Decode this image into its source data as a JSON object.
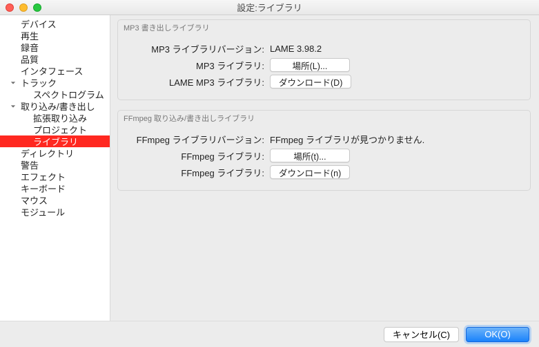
{
  "window": {
    "title": "設定:ライブラリ"
  },
  "sidebar": {
    "items": [
      {
        "label": "デバイス"
      },
      {
        "label": "再生"
      },
      {
        "label": "録音"
      },
      {
        "label": "品質"
      },
      {
        "label": "インタフェース"
      },
      {
        "label": "トラック"
      },
      {
        "label": "スペクトログラム"
      },
      {
        "label": "取り込み/書き出し"
      },
      {
        "label": "拡張取り込み"
      },
      {
        "label": "プロジェクト"
      },
      {
        "label": "ライブラリ"
      },
      {
        "label": "ディレクトリ"
      },
      {
        "label": "警告"
      },
      {
        "label": "エフェクト"
      },
      {
        "label": "キーボード"
      },
      {
        "label": "マウス"
      },
      {
        "label": "モジュール"
      }
    ]
  },
  "groups": {
    "mp3": {
      "title": "MP3 書き出しライブラリ",
      "rows": {
        "version_label": "MP3 ライブラリバージョン:",
        "version_value": "LAME 3.98.2",
        "lib_label": "MP3 ライブラリ:",
        "lib_button": "場所(L)...",
        "dl_label": "LAME MP3 ライブラリ:",
        "dl_button": "ダウンロード(D)"
      }
    },
    "ffmpeg": {
      "title": "FFmpeg 取り込み/書き出しライブラリ",
      "rows": {
        "version_label": "FFmpeg ライブラリバージョン:",
        "version_value": "FFmpeg ライブラリが見つかりません.",
        "lib_label": "FFmpeg ライブラリ:",
        "lib_button": "場所(t)...",
        "dl_label": "FFmpeg ライブラリ:",
        "dl_button": "ダウンロード(n)"
      }
    }
  },
  "footer": {
    "cancel": "キャンセル(C)",
    "ok": "OK(O)"
  }
}
